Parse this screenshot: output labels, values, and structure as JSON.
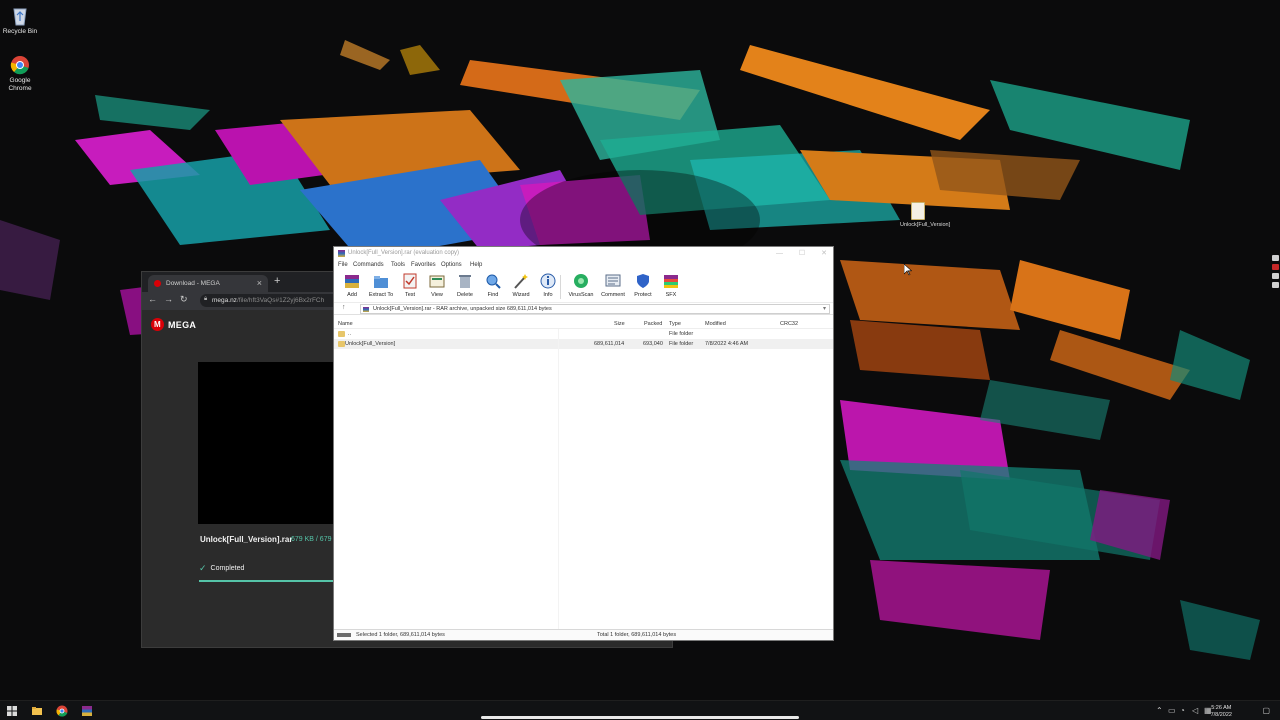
{
  "desktop": {
    "icons": [
      {
        "label": "Recycle Bin"
      },
      {
        "label": "Google Chrome"
      }
    ],
    "file_icon": {
      "label": "Unlock[Full_Version]"
    }
  },
  "browser": {
    "tab_title": "Download - MEGA",
    "url_host": "mega.nz",
    "url_path": "/file/hft3VaQs#1Z2yj6Bx2rFCh",
    "brand": "MEGA",
    "file_name": "Unlock[Full_Version].rar",
    "file_size": "679 KB / 679",
    "status": "Completed",
    "progress_percent": 100
  },
  "winrar": {
    "title": "Unlock[Full_Version].rar (evaluation copy)",
    "menu": [
      "File",
      "Commands",
      "Tools",
      "Favorites",
      "Options",
      "Help"
    ],
    "tools": [
      {
        "label": "Add",
        "icon": "add-icon"
      },
      {
        "label": "Extract To",
        "icon": "extract-to-icon"
      },
      {
        "label": "Test",
        "icon": "test-icon"
      },
      {
        "label": "View",
        "icon": "view-icon"
      },
      {
        "label": "Delete",
        "icon": "delete-icon"
      },
      {
        "label": "Find",
        "icon": "find-icon"
      },
      {
        "label": "Wizard",
        "icon": "wizard-icon"
      },
      {
        "label": "Info",
        "icon": "info-icon"
      },
      {
        "label": "VirusScan",
        "icon": "virusscan-icon"
      },
      {
        "label": "Comment",
        "icon": "comment-icon"
      },
      {
        "label": "Protect",
        "icon": "protect-icon"
      },
      {
        "label": "SFX",
        "icon": "sfx-icon"
      }
    ],
    "path": "Unlock[Full_Version].rar - RAR archive, unpacked size 689,611,014 bytes",
    "columns": [
      "Name",
      "Size",
      "Packed",
      "Type",
      "Modified",
      "CRC32"
    ],
    "rows": [
      {
        "name": "..",
        "size": "",
        "packed": "",
        "type": "File folder",
        "modified": "",
        "crc": ""
      },
      {
        "name": "Unlock[Full_Version]",
        "size": "689,611,014",
        "packed": "693,040",
        "type": "File folder",
        "modified": "7/8/2022 4:46 AM",
        "crc": ""
      }
    ],
    "status_left": "Selected 1 folder, 689,611,014 bytes",
    "status_right": "Total 1 folder, 689,611,014 bytes"
  },
  "taskbar": {
    "time": "5:26 AM",
    "date": "7/8/2022"
  },
  "colors": {
    "mega_red": "#d90007",
    "mega_green": "#55c4a8",
    "winrar_bg": "#ffffff"
  }
}
